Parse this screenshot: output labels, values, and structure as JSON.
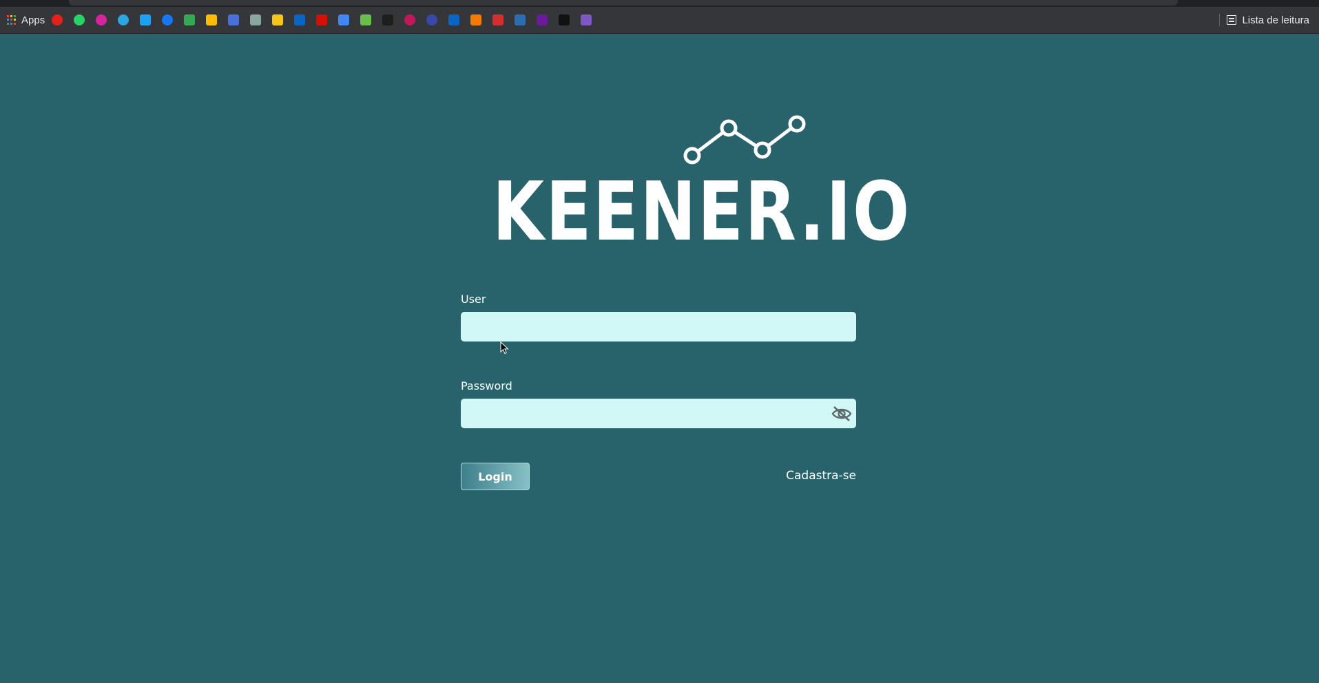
{
  "browser": {
    "apps_label": "Apps",
    "reading_list_label": "Lista de leitura",
    "bookmarks": [
      {
        "icon": "youtube-icon",
        "color": "#e62117"
      },
      {
        "icon": "whatsapp-icon",
        "color": "#25d366"
      },
      {
        "icon": "instagram-icon",
        "color": "#d6249f"
      },
      {
        "icon": "telegram-icon",
        "color": "#2ca5e0"
      },
      {
        "icon": "twitter-icon",
        "color": "#1da1f2"
      },
      {
        "icon": "facebook-icon",
        "color": "#1877f2"
      },
      {
        "icon": "google-drive-icon",
        "color": "#34a853"
      },
      {
        "icon": "google-photos-icon",
        "color": "#fbbc04"
      },
      {
        "icon": "google-docs-icon",
        "color": "#4a6fd8"
      },
      {
        "icon": "image-bookmark-icon",
        "color": "#8aa6a0"
      },
      {
        "icon": "google-keep-icon",
        "color": "#f5c518"
      },
      {
        "icon": "linkedin-icon",
        "color": "#0a66c2"
      },
      {
        "icon": "lastfm-icon",
        "color": "#d51007"
      },
      {
        "icon": "pinwheel-icon",
        "color": "#4285f4"
      },
      {
        "icon": "green-book-icon",
        "color": "#6abf4b"
      },
      {
        "icon": "scribd-icon",
        "color": "#1e1e1e"
      },
      {
        "icon": "red-circle-icon",
        "color": "#c2185b"
      },
      {
        "icon": "blue-heart-icon",
        "color": "#3949ab"
      },
      {
        "icon": "linkedin-icon",
        "color": "#0a66c2"
      },
      {
        "icon": "orange-bookmark-icon",
        "color": "#f57c00"
      },
      {
        "icon": "red-bookmark-icon",
        "color": "#d32f2f"
      },
      {
        "icon": "code-bookmark-icon",
        "color": "#2c6db2"
      },
      {
        "icon": "purple-bookmark-icon",
        "color": "#6a1b9a"
      },
      {
        "icon": "black-bookmark-icon",
        "color": "#111111"
      },
      {
        "icon": "colorful-bookmark-icon",
        "color": "#7e57c2"
      }
    ]
  },
  "logo": {
    "text": "KEENER.IO"
  },
  "form": {
    "user_label": "User",
    "user_value": "",
    "password_label": "Password",
    "password_value": "",
    "login_label": "Login",
    "signup_label": "Cadastra-se"
  },
  "colors": {
    "background": "#28636c",
    "input_bg": "#d2f7f7"
  }
}
